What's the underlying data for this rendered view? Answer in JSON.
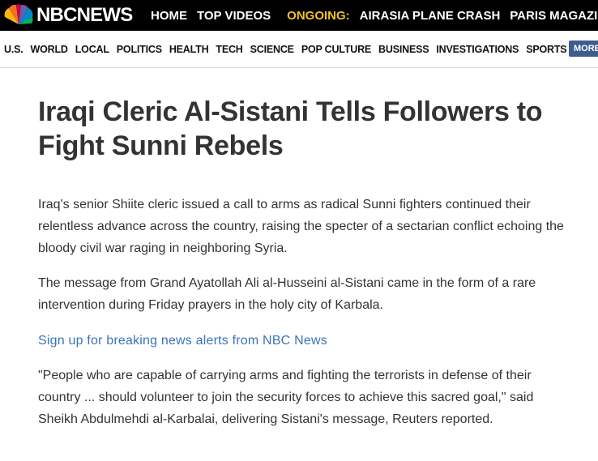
{
  "header": {
    "logo_text": "NBCNEWS",
    "top_nav": [
      "HOME",
      "TOP VIDEOS"
    ],
    "ongoing_label": "ONGOING:",
    "ongoing_items": [
      "AIRASIA PLANE CRASH",
      "PARIS MAGAZINE"
    ],
    "colors": {
      "background": "#000000",
      "ongoing": "#f1c21f"
    }
  },
  "subnav": {
    "items": [
      "U.S.",
      "WORLD",
      "LOCAL",
      "POLITICS",
      "HEALTH",
      "TECH",
      "SCIENCE",
      "POP CULTURE",
      "BUSINESS",
      "INVESTIGATIONS",
      "SPORTS"
    ],
    "more_label": "MORE",
    "colors": {
      "more_button": "#3f5c8f"
    }
  },
  "article": {
    "headline": "Iraqi Cleric Al-Sistani Tells Followers to Fight Sunni Rebels",
    "paragraphs": [
      "Iraq's senior Shiite cleric issued a call to arms as radical Sunni fighters continued their relentless advance across the country, raising the specter of a sectarian conflict echoing the bloody civil war raging in neighboring Syria.",
      "The message from Grand Ayatollah Ali al-Husseini al-Sistani came in the form of a rare intervention during Friday prayers in the holy city of Karbala.",
      "\"People who are capable of carrying arms and fighting the terrorists in defense of their country ... should volunteer to join the security forces to achieve this sacred goal,\" said Sheikh Abdulmehdi al-Karbalai, delivering Sistani's message, Reuters reported."
    ],
    "signup_link": "Sign up for breaking news alerts from NBC News",
    "colors": {
      "link": "#3b73b9",
      "text": "#333333"
    }
  }
}
